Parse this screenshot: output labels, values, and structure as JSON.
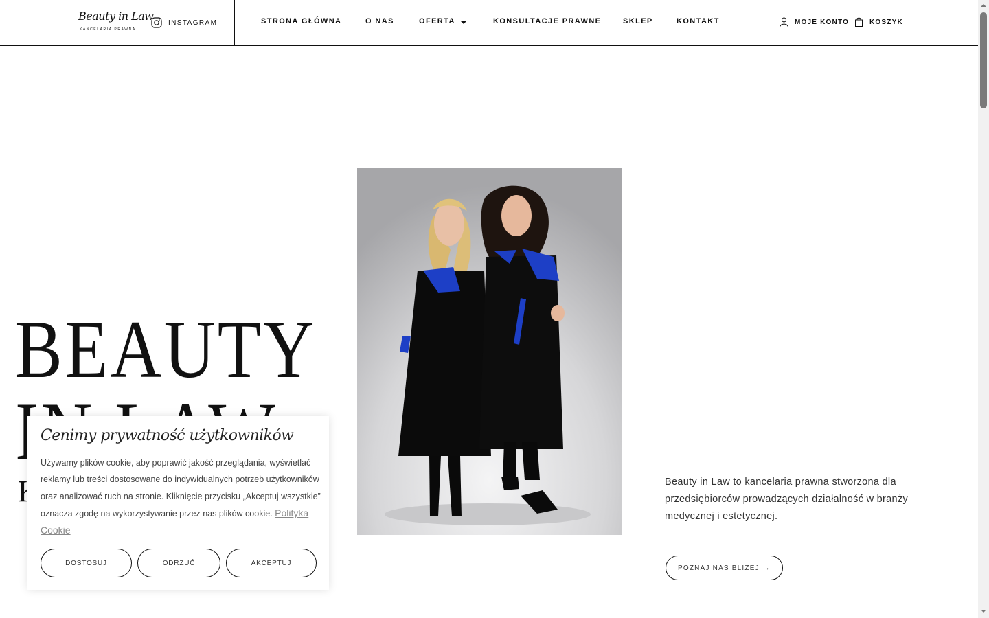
{
  "brand": {
    "logo_script": "Beauty in Law",
    "logo_sub": "KANCELARIA PRAWNA"
  },
  "header": {
    "instagram_label": "INSTAGRAM",
    "nav": [
      "STRONA GŁÓWNA",
      "O NAS",
      "OFERTA",
      "KONSULTACJE PRAWNE",
      "SKLEP",
      "KONTAKT"
    ],
    "account_label": "MOJE KONTO",
    "cart_label": "KOSZYK"
  },
  "hero": {
    "title_line1": "BEAUTY",
    "title_line2": "IN LAW",
    "subtitle": "K",
    "description": "Beauty in Law to kancelaria prawna stworzona dla przedsiębiorców prowadzących działalność w branży medycznej i estetycznej.",
    "cta_label": "POZNAJ NAS BLIŻEJ",
    "cta_arrow": "→"
  },
  "cookie": {
    "title": "Cenimy prywatność użytkowników",
    "text": "Używamy plików cookie, aby poprawić jakość przeglądania, wyświetlać reklamy lub treści dostosowane do indywidualnych potrzeb użytkowników oraz analizować ruch na stronie. Kliknięcie przycisku „Akceptuj wszystkie” oznacza zgodę na wykorzystywanie przez nas plików cookie.",
    "policy_link": "Polityka Cookie",
    "customize_label": "DOSTOSUJ",
    "reject_label": "ODRZUĆ",
    "accept_label": "AKCEPTUJ"
  },
  "colors": {
    "text": "#111111",
    "robe": "#0a0a0a",
    "collar_blue": "#1d3fc6",
    "photo_bg": "#d4d4d6"
  },
  "icons": {
    "instagram": "instagram-icon",
    "account": "user-icon",
    "cart": "bag-icon",
    "dropdown": "caret-down-icon"
  }
}
